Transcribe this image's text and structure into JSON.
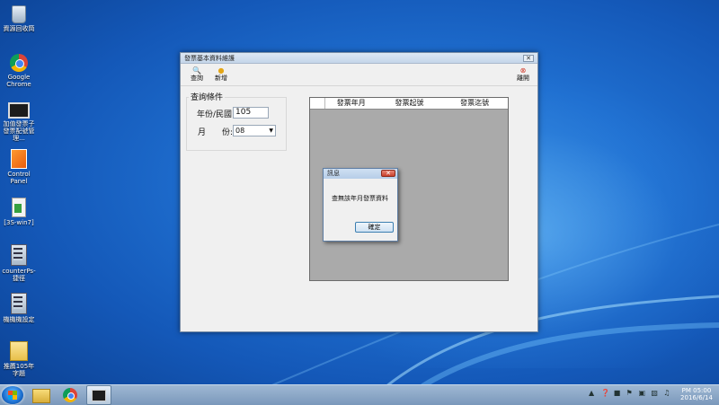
{
  "desktop": {
    "icons": [
      {
        "label": "資源回收筒",
        "icon": "recycle-bin-icon"
      },
      {
        "label": "Google Chrome",
        "icon": "chrome-icon"
      },
      {
        "label": "加值發票子發票配號管理...",
        "icon": "monitor-app-icon"
      },
      {
        "label": "Control Panel",
        "icon": "control-panel-icon"
      },
      {
        "label": "[3S-win7]",
        "icon": "file-icon"
      },
      {
        "label": "counterPs-捷徑",
        "icon": "shortcut-icon"
      },
      {
        "label": "機機機設定",
        "icon": "settings-shortcut-icon"
      },
      {
        "label": "推薦105年字題",
        "icon": "folder-icon"
      }
    ]
  },
  "window": {
    "title": "發票基本資料維護",
    "close_glyph": "✕",
    "toolbar": {
      "query_label": "查詢",
      "add_label": "新增",
      "leave_label": "離開"
    },
    "query_group": {
      "title": "查詢條件",
      "year_label": "年份/民國:",
      "year_value": "105",
      "month_label_1": "月",
      "month_label_2": "份:",
      "month_value": "08"
    },
    "grid": {
      "columns": [
        "發票年月",
        "發票起號",
        "發票迄號"
      ]
    }
  },
  "dialog": {
    "title": "訊息",
    "message": "查無該年月發票資料",
    "ok_label": "確定",
    "close_glyph": "✕"
  },
  "taskbar": {
    "time": "PM 05:00",
    "date": "2016/6/14"
  },
  "colors": {
    "desktop": "#1c6acb",
    "grid_bg": "#aaaaaa",
    "window_bg": "#f0f0f0"
  }
}
